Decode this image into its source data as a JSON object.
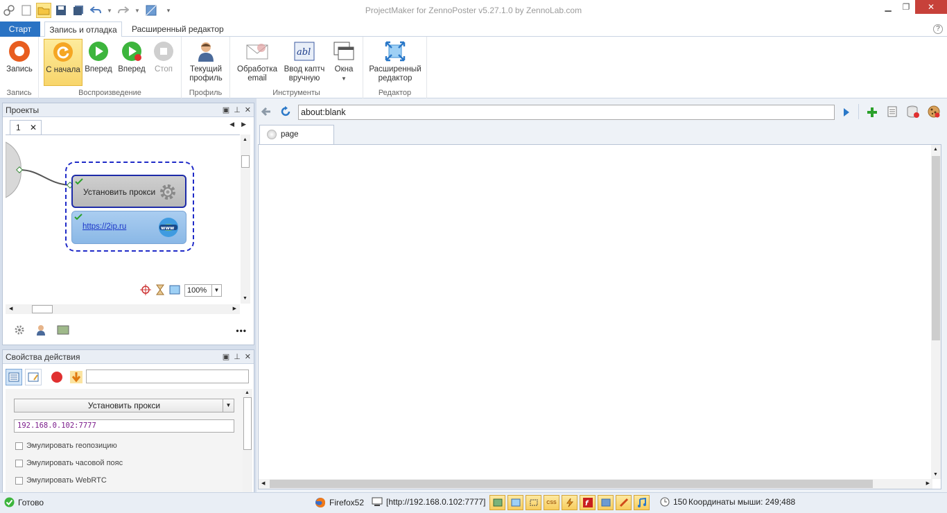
{
  "window": {
    "title": "ProjectMaker for ZennoPoster v5.27.1.0 by ZennoLab.com"
  },
  "ribbon_tabs": {
    "start": "Старт",
    "record_debug": "Запись и отладка",
    "advanced_editor": "Расширенный редактор"
  },
  "ribbon": {
    "record_group": {
      "label": "Запись",
      "record_btn": "Запись"
    },
    "playback_group": {
      "label": "Воспроизведение",
      "from_start": "С начала",
      "forward1": "Вперед",
      "forward2": "Вперед",
      "stop": "Стоп"
    },
    "profile_group": {
      "label": "Профиль",
      "current_profile_l1": "Текущий",
      "current_profile_l2": "профиль"
    },
    "tools_group": {
      "label": "Инструменты",
      "email_l1": "Обработка",
      "email_l2": "email",
      "captcha_l1": "Ввод каптч",
      "captcha_l2": "вручную",
      "windows": "Окна"
    },
    "editor_group": {
      "label": "Редактор",
      "adv_l1": "Расширенный",
      "adv_l2": "редактор"
    }
  },
  "projects_panel": {
    "title": "Проекты",
    "tab_label": "1",
    "nodes": {
      "proxy_label": "Установить прокси",
      "url_label": "https://2ip.ru"
    },
    "zoom_value": "100%"
  },
  "props_panel": {
    "title": "Свойства действия",
    "action_select": "Установить прокси",
    "proxy_value": "192.168.0.102:7777",
    "checkboxes": [
      {
        "label": "Эмулировать геопозицию",
        "checked": false
      },
      {
        "label": "Эмулировать часовой пояс",
        "checked": false
      },
      {
        "label": "Эмулировать WebRTC",
        "checked": false
      }
    ]
  },
  "browser": {
    "url": "about:blank",
    "tab_label": "page"
  },
  "statusbar": {
    "status": "Готово",
    "browser": "Firefox52",
    "proxy": "[http://192.168.0.102:7777]",
    "timer": "150",
    "mouse_coords": "Координаты мыши: 249;488"
  }
}
